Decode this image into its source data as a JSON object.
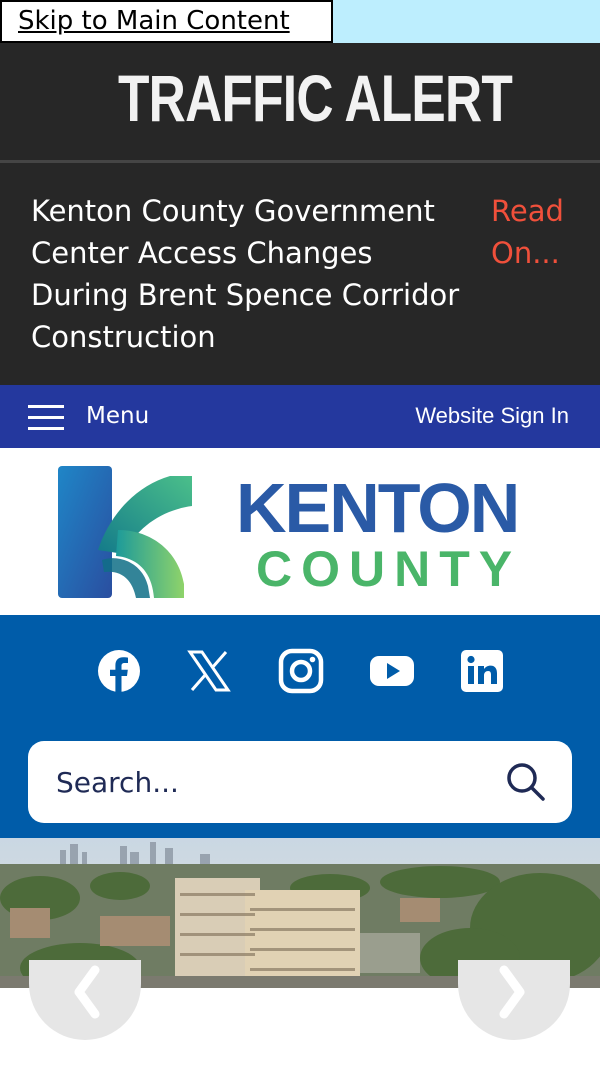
{
  "skip_link": "Skip to Main Content",
  "alert": {
    "title": "TRAFFIC ALERT",
    "lines": [
      "Kenton County Government",
      "Center Access Changes",
      "During Brent Spence Corridor",
      "Construction"
    ],
    "read_on": [
      "Read",
      "On..."
    ]
  },
  "menubar": {
    "menu_label": "Menu",
    "signin_label": "Website Sign In"
  },
  "logo": {
    "line1": "KENTON",
    "line2": "COUNTY"
  },
  "social": [
    "facebook-icon",
    "x-icon",
    "instagram-icon",
    "youtube-icon",
    "linkedin-icon"
  ],
  "search": {
    "placeholder": "Search..."
  },
  "colors": {
    "alert_bg": "#272727",
    "menubar_bg": "#24389e",
    "social_band_bg": "#005ca9",
    "read_on": "#f0503b",
    "kenton_blue": "#2a5aa6",
    "county_green": "#4ab569"
  }
}
